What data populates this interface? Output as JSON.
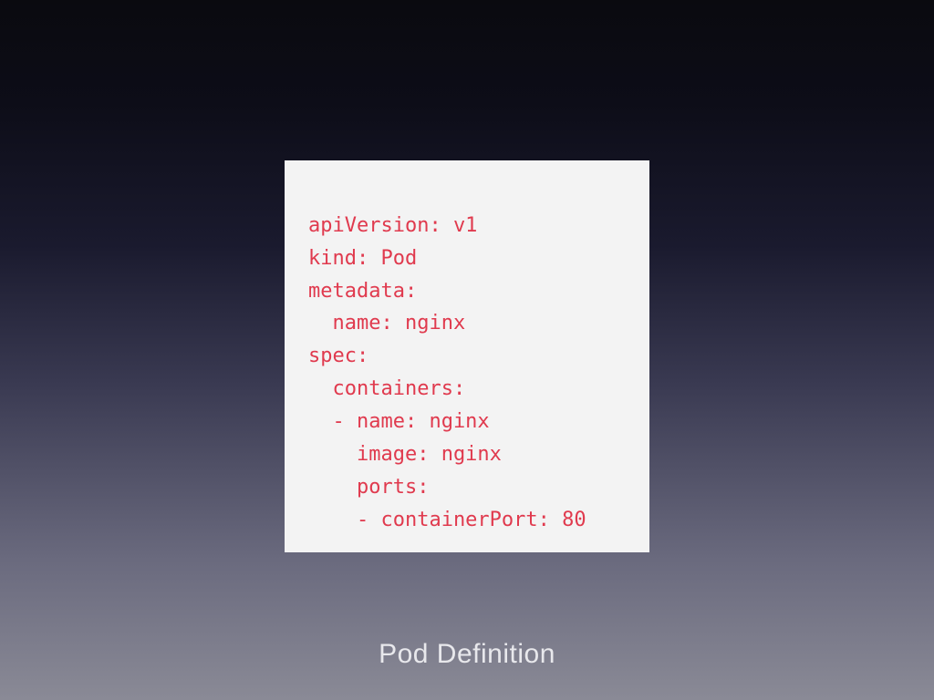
{
  "code": {
    "lines": [
      "apiVersion: v1",
      "kind: Pod",
      "metadata:",
      "  name: nginx",
      "spec:",
      "  containers:",
      "  - name: nginx",
      "    image: nginx",
      "    ports:",
      "    - containerPort: 80"
    ]
  },
  "caption": "Pod Definition"
}
